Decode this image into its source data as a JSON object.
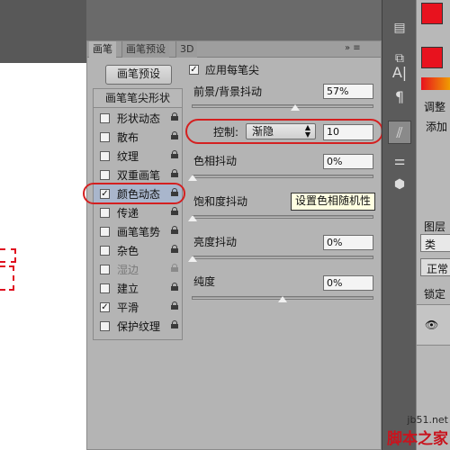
{
  "panel": {
    "tabs": [
      "画笔",
      "画笔预设",
      "3D"
    ],
    "menu_icon": "»  ≡",
    "preset_button": "画笔预设",
    "list_header": "画笔笔尖形状",
    "brush_options": [
      {
        "label": "形状动态",
        "checked": false
      },
      {
        "label": "散布",
        "checked": false
      },
      {
        "label": "纹理",
        "checked": false
      },
      {
        "label": "双重画笔",
        "checked": false
      },
      {
        "label": "颜色动态",
        "checked": true
      },
      {
        "label": "传递",
        "checked": false
      },
      {
        "label": "画笔笔势",
        "checked": false
      },
      {
        "label": "杂色",
        "checked": false
      },
      {
        "label": "湿边",
        "checked": false
      },
      {
        "label": "建立",
        "checked": false
      },
      {
        "label": "平滑",
        "checked": true
      },
      {
        "label": "保护纹理",
        "checked": false
      }
    ],
    "apply_per_tip": {
      "label": "应用每笔尖",
      "checked": true
    },
    "fg_bg_jitter": {
      "label": "前景/背景抖动",
      "value": "57%",
      "level": 0.57
    },
    "control": {
      "label": "控制:",
      "value": "渐隐",
      "fade_steps": "10"
    },
    "hue_jitter": {
      "label": "色相抖动",
      "value": "0%",
      "level": 0
    },
    "saturation_jitter": {
      "label": "饱和度抖动",
      "level": 0
    },
    "tooltip": "设置色相随机性",
    "brightness_jitter": {
      "label": "亮度抖动",
      "value": "0%",
      "level": 0
    },
    "purity": {
      "label": "纯度",
      "value": "0%",
      "level": 0.5
    }
  },
  "right_panel": {
    "adjustments_label": "调整",
    "add_label": "添加",
    "layers_label": "图层",
    "search_label": "类",
    "blend_mode": "正常",
    "lock_label": "锁定"
  },
  "colors": {
    "annotation": "#d42020",
    "stroke": "#e01020",
    "foreground": "#e8121e",
    "selected_row": "#a9b6cc"
  },
  "watermark": {
    "url": "jb51.net",
    "name": "脚本之家"
  }
}
